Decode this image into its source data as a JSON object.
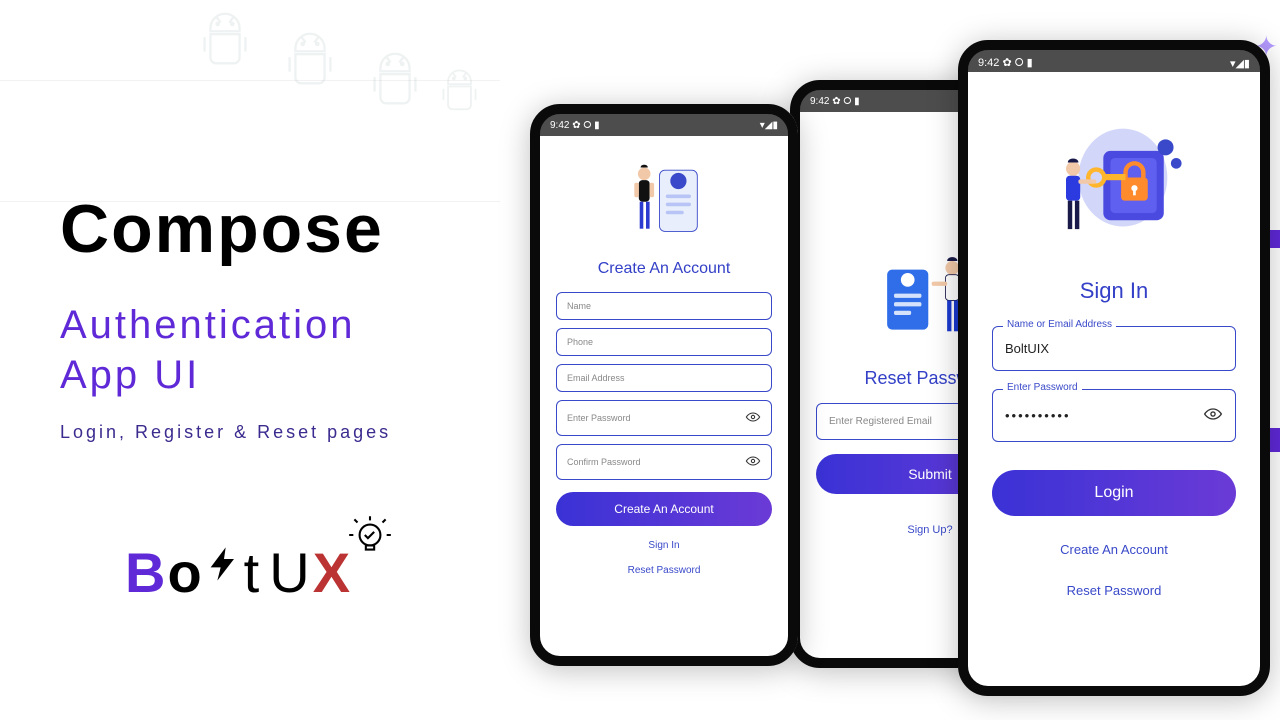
{
  "hero": {
    "headline": "Compose",
    "sub_line1": "Authentication",
    "sub_line2": "App UI",
    "sub_detail": "Login, Register & Reset pages"
  },
  "logo": {
    "prefix": "B",
    "mid1": "o",
    "mid2": "t",
    "mid3": "U",
    "suffix": "X"
  },
  "status": {
    "time": "9:42",
    "signal": "▮◢",
    "battery": "▮"
  },
  "phone_register": {
    "title": "Create An Account",
    "fields": {
      "name": "Name",
      "phone": "Phone",
      "email": "Email Address",
      "password": "Enter Password",
      "confirm": "Confirm Password"
    },
    "button": "Create An Account",
    "link_signin": "Sign In",
    "link_reset": "Reset Password"
  },
  "phone_reset": {
    "title": "Reset Password",
    "fields": {
      "email": "Enter Registered Email"
    },
    "button": "Submit",
    "link_signup": "Sign Up?"
  },
  "phone_login": {
    "title": "Sign In",
    "fields": {
      "id_label": "Name or Email Address",
      "id_value": "BoltUIX",
      "pw_label": "Enter Password",
      "pw_value": "••••••••••"
    },
    "button": "Login",
    "link_create": "Create An Account",
    "link_reset": "Reset Password"
  },
  "colors": {
    "primary": "#5f29d8",
    "field_border": "#3949c9"
  }
}
